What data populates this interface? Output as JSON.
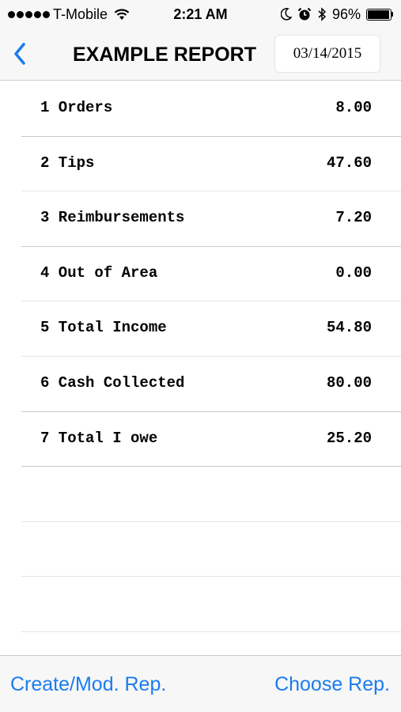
{
  "status_bar": {
    "carrier": "T-Mobile",
    "time": "2:21 AM",
    "battery": "96%",
    "battery_level": 0.96,
    "icons": [
      "signal-icon",
      "wifi-icon",
      "moon-icon",
      "alarm-icon",
      "bluetooth-icon",
      "battery-icon"
    ]
  },
  "nav": {
    "back_icon": "chevron-left-icon",
    "title": "EXAMPLE REPORT",
    "date": "03/14/2015"
  },
  "rows": [
    {
      "label": "1 Orders",
      "value": "8.00"
    },
    {
      "label": "2 Tips",
      "value": "47.60"
    },
    {
      "label": "3 Reimbursements",
      "value": "7.20"
    },
    {
      "label": "4 Out of Area",
      "value": "0.00"
    },
    {
      "label": "5 Total Income",
      "value": "54.80"
    },
    {
      "label": "6 Cash Collected",
      "value": "80.00"
    },
    {
      "label": "7 Total I owe",
      "value": "25.20"
    }
  ],
  "toolbar": {
    "create_label": "Create/Mod. Rep.",
    "choose_label": "Choose Rep."
  },
  "colors": {
    "accent": "#1a7cf0",
    "bar_background": "#f7f7f7",
    "separator": "#c8c8cc"
  }
}
